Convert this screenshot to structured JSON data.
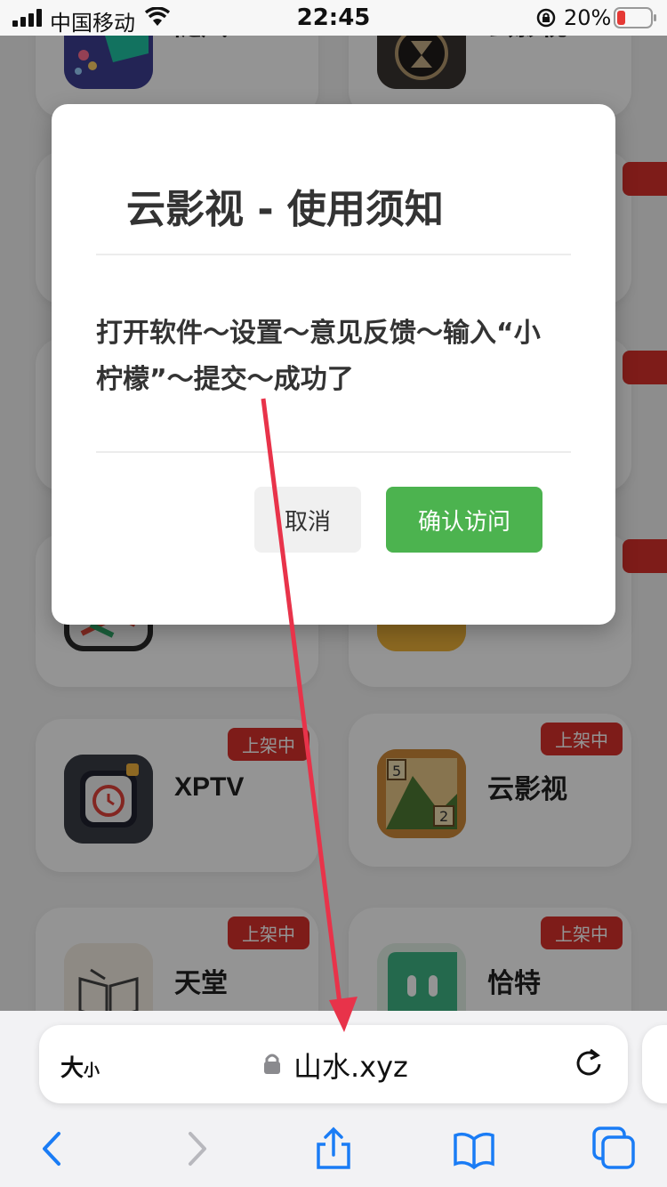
{
  "status_bar": {
    "carrier": "中国移动",
    "time": "22:45",
    "battery": "20%"
  },
  "cards": [
    {
      "name": "随风",
      "badge": ""
    },
    {
      "name": "云影视",
      "badge": ""
    },
    {
      "name": "XPTV",
      "badge": "上架中"
    },
    {
      "name": "云影视",
      "badge": "上架中"
    },
    {
      "name": "天堂",
      "badge": "上架中"
    },
    {
      "name": "恰特",
      "badge": "上架中"
    }
  ],
  "modal": {
    "title": "云影视 - 使用须知",
    "body": "打开软件～设置～意见反馈～输入“小柠檬”～提交～成功了",
    "cancel_label": "取消",
    "confirm_label": "确认访问"
  },
  "browser": {
    "text_size_big": "大",
    "text_size_small": "小",
    "url": "山水.xyz"
  },
  "colors": {
    "badge": "#d9312b",
    "confirm": "#4cb34f",
    "arrow": "#e8334a",
    "toolbar_blue": "#1a7cf5"
  }
}
